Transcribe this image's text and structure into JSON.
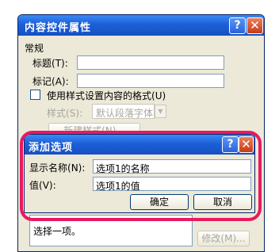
{
  "outer_dialog": {
    "title": "内容控件属性",
    "help_glyph": "?",
    "close_glyph": "✕",
    "section_general": "常规",
    "title_label": "标题",
    "title_key": "(T):",
    "tag_label": "标记",
    "tag_key": "(A):",
    "style_checkbox_label": "使用样式设置内容的格式",
    "style_checkbox_key": "(U)",
    "style_label": "样式",
    "style_key": "(S):",
    "style_value": "默认段落字体",
    "new_style_button": "新建样式(N)...",
    "list_item": "选择一项。",
    "modify_button": "修改(M)..."
  },
  "inner_dialog": {
    "title": "添加选项",
    "help_glyph": "?",
    "close_glyph": "✕",
    "display_name_label": "显示名称",
    "display_name_key": "(N):",
    "display_name_value": "选项1的名称",
    "value_label": "值",
    "value_key": "(V):",
    "value_value": "选项1的值",
    "ok_button": "确定",
    "cancel_button": "取消"
  },
  "colors": {
    "highlight": "#e8195f",
    "titlebar": "#1c5fd6",
    "dialog_face": "#ece9d8"
  }
}
